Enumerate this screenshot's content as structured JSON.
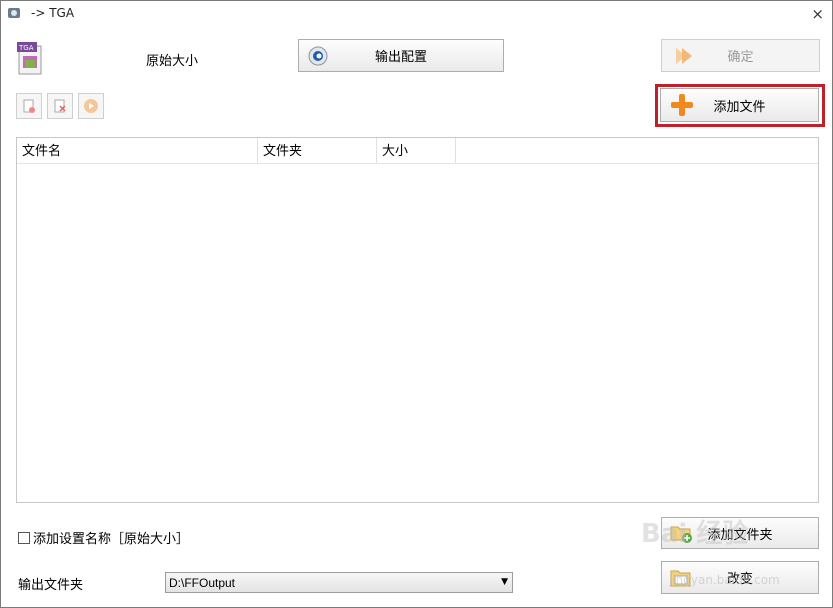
{
  "window": {
    "title": "-> TGA",
    "close_glyph": "×"
  },
  "format": {
    "icon_text": "TGA",
    "size_label": "原始大小"
  },
  "buttons": {
    "output_config": "输出配置",
    "confirm": "确定",
    "add_file": "添加文件",
    "add_folder": "添加文件夹",
    "change": "改变"
  },
  "list": {
    "columns": [
      "文件名",
      "文件夹",
      "大小"
    ],
    "rows": []
  },
  "options": {
    "add_setting_name": "添加设置名称［原始大小］",
    "add_setting_name_checked": false
  },
  "output": {
    "label": "输出文件夹",
    "folder": "D:\\FFOutput"
  },
  "colors": {
    "highlight": "#c0202a",
    "accent_orange": "#f08a1e"
  },
  "watermark": {
    "main": "Bai 经验",
    "sub": "jingyan.baidu.com"
  }
}
